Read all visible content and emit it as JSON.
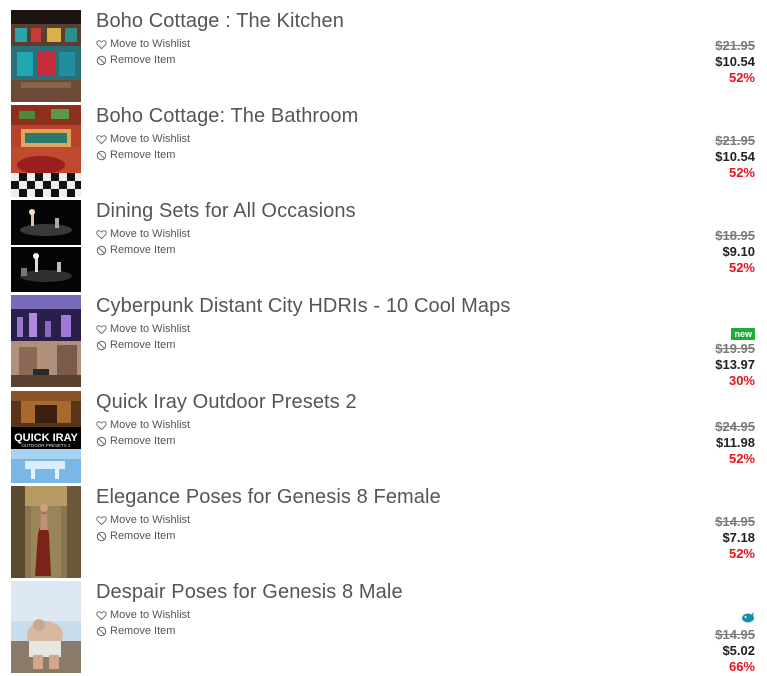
{
  "items": [
    {
      "title": "Boho Cottage : The Kitchen",
      "wishlist_label": "Move to Wishlist",
      "remove_label": "Remove Item",
      "old_price": "$21.95",
      "price": "$10.54",
      "discount": "52%"
    },
    {
      "title": "Boho Cottage: The Bathroom",
      "wishlist_label": "Move to Wishlist",
      "remove_label": "Remove Item",
      "old_price": "$21.95",
      "price": "$10.54",
      "discount": "52%"
    },
    {
      "title": "Dining Sets for All Occasions",
      "wishlist_label": "Move to Wishlist",
      "remove_label": "Remove Item",
      "old_price": "$18.95",
      "price": "$9.10",
      "discount": "52%"
    },
    {
      "title": "Cyberpunk Distant City HDRIs - 10 Cool Maps",
      "wishlist_label": "Move to Wishlist",
      "remove_label": "Remove Item",
      "badge": "new",
      "old_price": "$19.95",
      "price": "$13.97",
      "discount": "30%"
    },
    {
      "title": "Quick Iray Outdoor Presets 2",
      "wishlist_label": "Move to Wishlist",
      "remove_label": "Remove Item",
      "thumb_text": "QUICK IRAY",
      "thumb_subtext": "OUTDOOR PRESETS 2",
      "old_price": "$24.95",
      "price": "$11.98",
      "discount": "52%"
    },
    {
      "title": "Elegance Poses for Genesis 8 Female",
      "wishlist_label": "Move to Wishlist",
      "remove_label": "Remove Item",
      "old_price": "$14.95",
      "price": "$7.18",
      "discount": "52%"
    },
    {
      "title": "Despair Poses for Genesis 8 Male",
      "wishlist_label": "Move to Wishlist",
      "remove_label": "Remove Item",
      "has_icon": true,
      "icon_name": "blue-creature-icon",
      "old_price": "$14.95",
      "price": "$5.02",
      "discount": "66%"
    }
  ],
  "colors": {
    "title": "#555555",
    "discount": "#e8121c",
    "new_badge": "#1fab3a",
    "old_price": "#7a7a7a"
  }
}
